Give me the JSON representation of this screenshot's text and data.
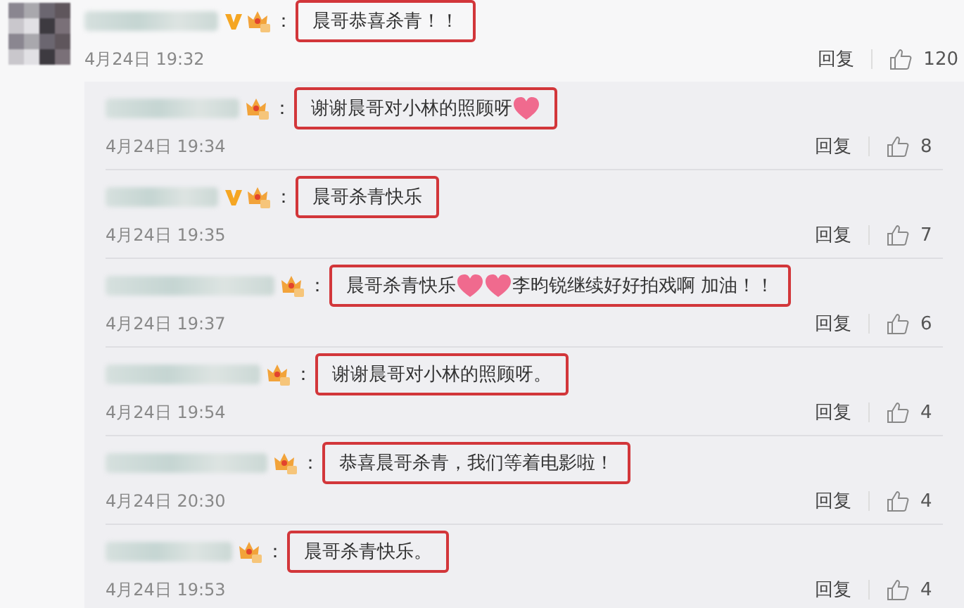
{
  "comment": {
    "separator": "：",
    "verified": true,
    "segments": [
      {
        "kind": "text",
        "text": "晨哥恭喜杀青！！"
      }
    ],
    "time": "4月24日 19:32",
    "reply_label": "回复",
    "likes": "120"
  },
  "replies": [
    {
      "separator": "：",
      "verified": false,
      "segments": [
        {
          "kind": "text",
          "text": "谢谢晨哥对小林的照顾呀"
        },
        {
          "kind": "emoji"
        }
      ],
      "time": "4月24日 19:34",
      "reply_label": "回复",
      "likes": "8"
    },
    {
      "separator": "：",
      "verified": true,
      "segments": [
        {
          "kind": "text",
          "text": "晨哥杀青快乐"
        }
      ],
      "time": "4月24日 19:35",
      "reply_label": "回复",
      "likes": "7"
    },
    {
      "separator": "：",
      "verified": false,
      "segments": [
        {
          "kind": "text",
          "text": "晨哥杀青快乐"
        },
        {
          "kind": "emoji"
        },
        {
          "kind": "emoji"
        },
        {
          "kind": "text",
          "text": "李昀锐继续好好拍戏啊 加油！！"
        }
      ],
      "time": "4月24日 19:37",
      "reply_label": "回复",
      "likes": "6"
    },
    {
      "separator": "：",
      "verified": false,
      "segments": [
        {
          "kind": "text",
          "text": "谢谢晨哥对小林的照顾呀。"
        }
      ],
      "time": "4月24日 19:54",
      "reply_label": "回复",
      "likes": "4"
    },
    {
      "separator": "：",
      "verified": false,
      "segments": [
        {
          "kind": "text",
          "text": "恭喜晨哥杀青，我们等着电影啦！"
        }
      ],
      "time": "4月24日 20:30",
      "reply_label": "回复",
      "likes": "4"
    },
    {
      "separator": "：",
      "verified": false,
      "segments": [
        {
          "kind": "text",
          "text": "晨哥杀青快乐。"
        }
      ],
      "time": "4月24日 19:53",
      "reply_label": "回复",
      "likes": "4"
    }
  ]
}
